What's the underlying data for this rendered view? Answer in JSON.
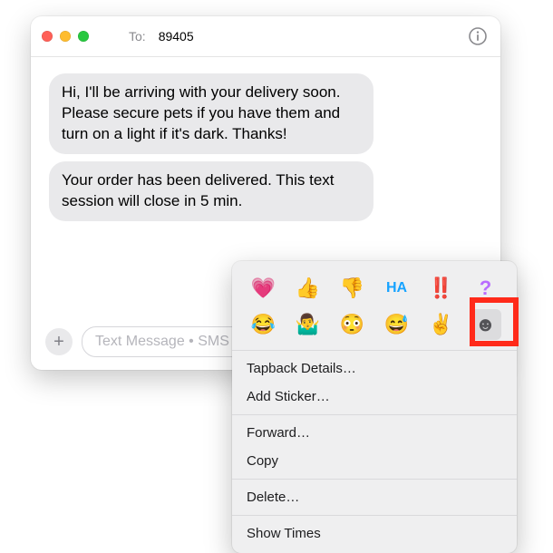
{
  "window": {
    "to_label": "To:",
    "recipient": "89405"
  },
  "messages": [
    "Hi, I'll be arriving with your delivery soon. Please secure pets if you have them and turn on a light if it's dark. Thanks!",
    "Your order has been delivered. This text session will close in 5 min."
  ],
  "compose": {
    "placeholder": "Text Message • SMS"
  },
  "tapback": {
    "row1": [
      "💗",
      "👍",
      "👎",
      "HA",
      "‼️",
      "?"
    ],
    "row2": [
      "😂",
      "🤷‍♂️",
      "😳",
      "😅",
      "✌️",
      "☻"
    ]
  },
  "menu": {
    "items_a": [
      "Tapback Details…",
      "Add Sticker…"
    ],
    "items_b": [
      "Forward…",
      "Copy"
    ],
    "items_c": [
      "Delete…"
    ],
    "items_d": [
      "Show Times"
    ]
  }
}
